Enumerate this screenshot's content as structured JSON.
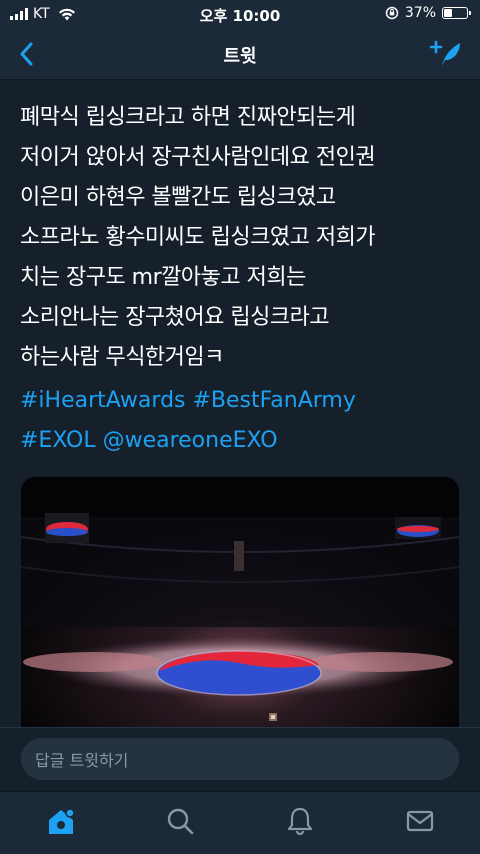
{
  "status_bar": {
    "carrier": "KT",
    "time": "오후 10:00",
    "battery_percent": "37%",
    "battery_level": 0.37
  },
  "header": {
    "title": "트윗",
    "back_icon": "chevron-left-icon",
    "compose_icon": "compose-tweet-icon"
  },
  "tweet": {
    "lines": [
      "폐막식 립싱크라고 하면 진짜안되는게",
      "저이거 앉아서 장구친사람인데요 전인권",
      "이은미 하현우 볼빨간도 립싱크였고",
      "소프라노 황수미씨도 립싱크였고 저희가",
      "치는 장구도 mr깔아놓고 저희는",
      "소리안나는 장구쳤어요 립싱크라고",
      "하는사람 무식한거임ㅋ"
    ],
    "hashtags": {
      "tag1": "#iHeartAwards",
      "tag2": "#BestFanArmy",
      "tag3": "#EXOL",
      "mention": "@weareoneEXO"
    }
  },
  "reply": {
    "placeholder": "답글 트윗하기"
  },
  "tabs": [
    "home-icon",
    "search-icon",
    "notifications-bell-icon",
    "messages-envelope-icon"
  ],
  "colors": {
    "background": "#15202b",
    "bar": "#1c2938",
    "accent": "#1da1f2"
  }
}
